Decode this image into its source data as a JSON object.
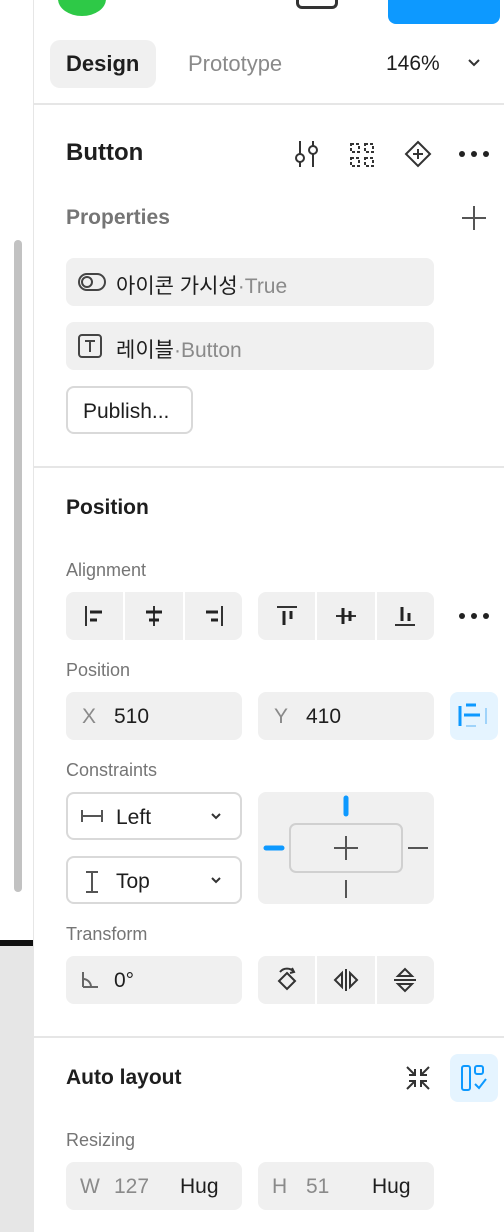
{
  "tabs": {
    "design": "Design",
    "prototype": "Prototype"
  },
  "zoom": {
    "value": "146%"
  },
  "component": {
    "title": "Button",
    "properties_label": "Properties",
    "properties": [
      {
        "name": "아이콘 가시성",
        "separator": "·",
        "value": "True",
        "icon": "toggle-icon"
      },
      {
        "name": "레이블",
        "separator": "·",
        "value": "Button",
        "icon": "text-icon"
      }
    ],
    "publish_label": "Publish..."
  },
  "position": {
    "title": "Position",
    "alignment_label": "Alignment",
    "position_label": "Position",
    "x_label": "X",
    "x_value": "510",
    "y_label": "Y",
    "y_value": "410",
    "constraints_label": "Constraints",
    "constraint_h": "Left",
    "constraint_v": "Top",
    "transform_label": "Transform",
    "rotation_value": "0°"
  },
  "auto_layout": {
    "title": "Auto layout",
    "resizing_label": "Resizing",
    "w_label": "W",
    "w_value": "127",
    "w_mode": "Hug",
    "h_label": "H",
    "h_value": "51",
    "h_mode": "Hug"
  },
  "colors": {
    "accent": "#0d99ff",
    "accent_bg": "#e5f4ff",
    "field_bg": "#f0f0f0"
  }
}
